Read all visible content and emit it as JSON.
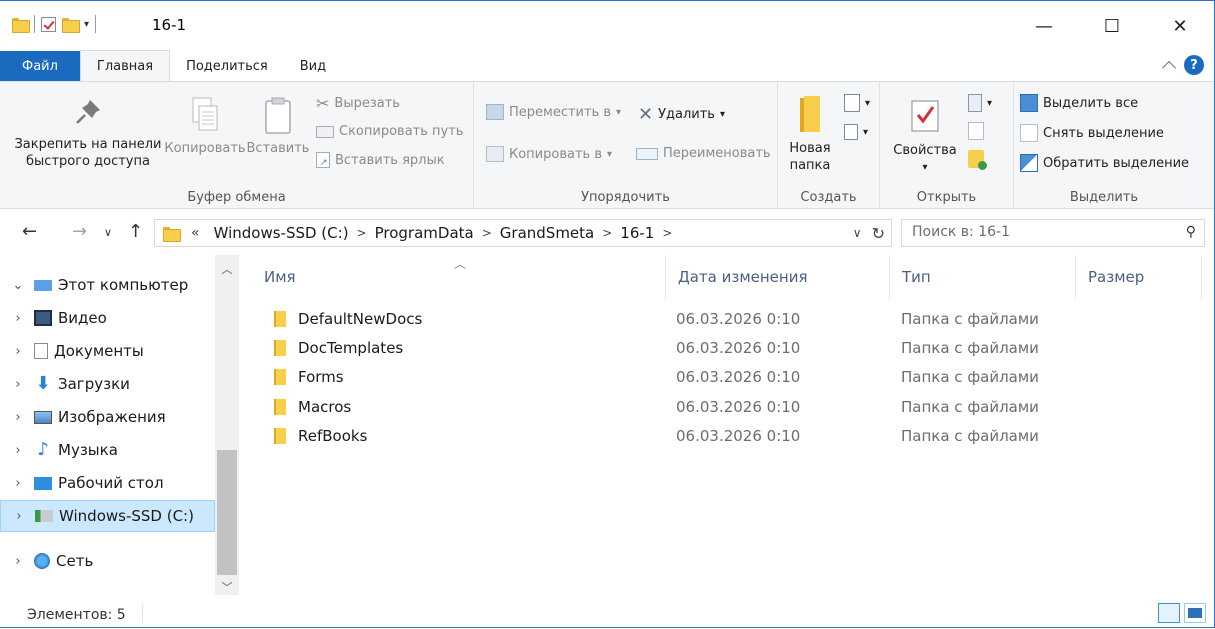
{
  "window": {
    "title": "16-1",
    "controls": {
      "minimize": "—",
      "maximize": "☐",
      "close": "✕"
    }
  },
  "ribbon_tabs": {
    "file": "Файл",
    "home": "Главная",
    "share": "Поделиться",
    "view": "Вид"
  },
  "ribbon": {
    "clipboard": {
      "label": "Буфер обмена",
      "pin": "Закрепить на панели быстрого доступа",
      "copy": "Копировать",
      "paste": "Вставить",
      "cut": "Вырезать",
      "copy_path": "Скопировать путь",
      "paste_shortcut": "Вставить ярлык"
    },
    "organize": {
      "label": "Упорядочить",
      "move_to": "Переместить в",
      "copy_to": "Копировать в",
      "delete": "Удалить",
      "rename": "Переименовать"
    },
    "new": {
      "label": "Создать",
      "new_folder": "Новая папка"
    },
    "open": {
      "label": "Открыть",
      "properties": "Свойства"
    },
    "select": {
      "label": "Выделить",
      "select_all": "Выделить все",
      "select_none": "Снять выделение",
      "invert": "Обратить выделение"
    }
  },
  "address": {
    "prefix": "«",
    "crumbs": [
      "Windows-SSD (C:)",
      "ProgramData",
      "GrandSmeta",
      "16-1"
    ],
    "search_placeholder": "Поиск в: 16-1"
  },
  "nav_pane": {
    "items": [
      {
        "label": "Этот компьютер",
        "icon": "computer-icon"
      },
      {
        "label": "Видео",
        "icon": "video-icon"
      },
      {
        "label": "Документы",
        "icon": "documents-icon"
      },
      {
        "label": "Загрузки",
        "icon": "downloads-icon"
      },
      {
        "label": "Изображения",
        "icon": "pictures-icon"
      },
      {
        "label": "Музыка",
        "icon": "music-icon"
      },
      {
        "label": "Рабочий стол",
        "icon": "desktop-icon"
      },
      {
        "label": "Windows-SSD (C:)",
        "icon": "drive-icon",
        "selected": true
      },
      {
        "label": "Сеть",
        "icon": "network-icon"
      }
    ]
  },
  "columns": {
    "name": "Имя",
    "date": "Дата изменения",
    "type": "Тип",
    "size": "Размер"
  },
  "files": [
    {
      "name": "DefaultNewDocs",
      "date": "06.03.2026 0:10",
      "type": "Папка с файлами"
    },
    {
      "name": "DocTemplates",
      "date": "06.03.2026 0:10",
      "type": "Папка с файлами"
    },
    {
      "name": "Forms",
      "date": "06.03.2026 0:10",
      "type": "Папка с файлами"
    },
    {
      "name": "Macros",
      "date": "06.03.2026 0:10",
      "type": "Папка с файлами"
    },
    {
      "name": "RefBooks",
      "date": "06.03.2026 0:10",
      "type": "Папка с файлами"
    }
  ],
  "status": {
    "count": "Элементов: 5"
  },
  "colors": {
    "accent": "#1a6bbf",
    "selection": "#cce8ff",
    "folder": "#f8cf4c"
  }
}
